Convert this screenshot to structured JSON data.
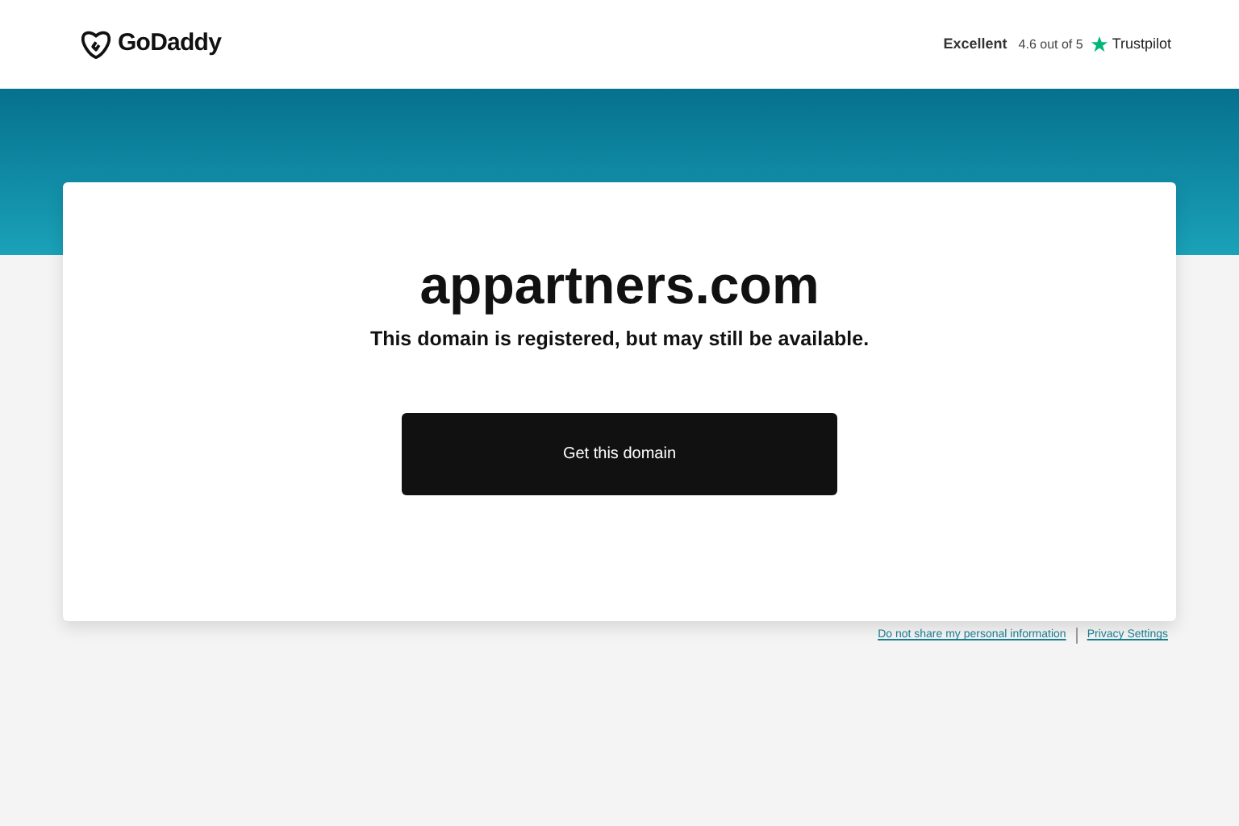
{
  "header": {
    "logo": "GoDaddy",
    "rating": {
      "label": "Excellent",
      "score": "4.6 out of 5",
      "brand": "Trustpilot"
    }
  },
  "card": {
    "domain": "appartners.com",
    "message": "This domain is registered, but may still be available.",
    "button": "Get this domain"
  },
  "footer_links": [
    "Do not share my personal information",
    "Privacy Settings"
  ]
}
